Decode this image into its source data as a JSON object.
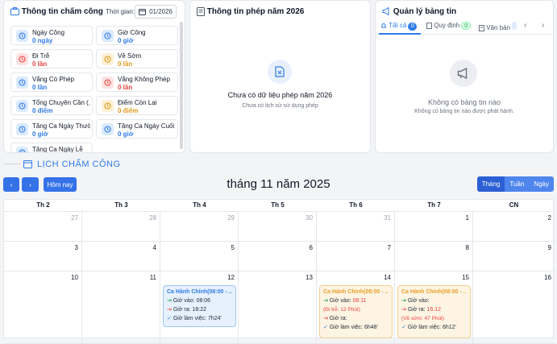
{
  "attendance_card": {
    "title": "Thông tin chấm công",
    "time_label": "Thời gian:",
    "time_value": "01/2026",
    "stats": [
      {
        "label": "Ngày Công",
        "value": "0 ngày",
        "icon": "briefcase-icon",
        "tone": "blue"
      },
      {
        "label": "Giờ Công",
        "value": "0 giờ",
        "icon": "clock-icon",
        "tone": "blue"
      },
      {
        "label": "Đi Trễ",
        "value": "0 lần",
        "icon": "clock-icon",
        "tone": "red"
      },
      {
        "label": "Về Sớm",
        "value": "0 lần",
        "icon": "clock-icon",
        "tone": "yellow"
      },
      {
        "label": "Vắng Có Phép",
        "value": "0 lần",
        "icon": "calendar-icon",
        "tone": "blue"
      },
      {
        "label": "Vắng Không Phép",
        "value": "0 lần",
        "icon": "user-x-icon",
        "tone": "red"
      },
      {
        "label": "Tổng Chuyên Cần (...",
        "value": "0 điểm",
        "icon": "minus-circle-icon",
        "tone": "blue"
      },
      {
        "label": "Điểm Còn Lại",
        "value": "0 điểm",
        "icon": "minus-circle-icon",
        "tone": "yellow"
      },
      {
        "label": "Tăng Ca Ngày Thườ...",
        "value": "0 giờ",
        "icon": "calendar-icon",
        "tone": "blue"
      },
      {
        "label": "Tăng Ca Ngày Cuối ...",
        "value": "0 giờ",
        "icon": "calendar-icon",
        "tone": "blue"
      },
      {
        "label": "Tăng Ca Ngày Lễ",
        "value": "",
        "icon": "calendar-icon",
        "tone": "blue"
      }
    ]
  },
  "leave_card": {
    "title": "Thông tin phép năm 2026",
    "empty_title": "Chưa có dữ liệu phép năm 2026",
    "empty_sub": "Chưa có lịch sử sử dụng phép"
  },
  "news_card": {
    "title": "Quản lý bảng tin",
    "tabs": [
      {
        "label": "Tất cả",
        "count": "0"
      },
      {
        "label": "Quy định",
        "count": "0"
      },
      {
        "label": "Văn bản",
        "count": ""
      }
    ],
    "empty_title": "Không có bảng tin nào",
    "empty_sub": "Không có bảng tin nào được phát hành."
  },
  "calendar": {
    "section_title": "LỊCH CHẤM CÔNG",
    "today_label": "Hôm nay",
    "month_title": "tháng 11 năm 2025",
    "views": [
      "Tháng",
      "Tuần",
      "Ngày"
    ],
    "weekdays": [
      "Th 2",
      "Th 3",
      "Th 4",
      "Th 5",
      "Th 6",
      "Th 7",
      "CN"
    ],
    "weeks": [
      [
        "27",
        "28",
        "29",
        "30",
        "31",
        "1",
        "2"
      ],
      [
        "3",
        "4",
        "5",
        "6",
        "7",
        "8",
        "9"
      ],
      [
        "10",
        "11",
        "12",
        "13",
        "14",
        "15",
        "16"
      ]
    ],
    "events": [
      {
        "shift": "Ca Hành Chính(08:00 - ...",
        "in_label": "Giờ vào:",
        "in": "08:06",
        "in_note": "",
        "out_label": "Giờ ra:",
        "out": "18:22",
        "out_note": "",
        "work_label": "Giờ làm việc:",
        "work": "7h24'"
      },
      {
        "shift": "Ca Hành Chính(08:00 - ...",
        "in_label": "Giờ vào:",
        "in": "08:11",
        "in_note": "(Đi trễ: 12 Phút)",
        "out_label": "Giờ ra:",
        "out": "",
        "out_note": "",
        "work_label": "Giờ làm việc:",
        "work": "6h48'"
      },
      {
        "shift": "Ca Hành Chính(08:00 - ...",
        "in_label": "Giờ vào:",
        "in": "",
        "in_note": "",
        "out_label": "Giờ ra:",
        "out": "16:12",
        "out_note": "(Về sớm: 47 Phút)",
        "work_label": "Giờ làm việc:",
        "work": "6h12'"
      }
    ]
  },
  "colors": {
    "accent": "#2f7be8",
    "late": "#ef4444",
    "warning": "#e8a02b"
  }
}
